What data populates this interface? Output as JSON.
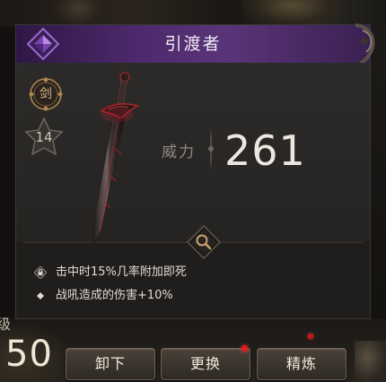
{
  "item": {
    "name": "引渡者",
    "type_badge": "剑",
    "rank": "14",
    "rarity_color": "#6a3a8c",
    "blood_accent": "#b3202a"
  },
  "stat": {
    "label": "威力",
    "value": "261"
  },
  "effects": [
    {
      "icon": "lock-icon",
      "text": "击中时15%几率附加即死"
    },
    {
      "icon": "diamond-bullet-icon",
      "text": "战吼造成的伤害+10%"
    }
  ],
  "background": {
    "level_label": "级",
    "level_value": "50"
  },
  "buttons": {
    "unequip": "卸下",
    "replace": "更换",
    "refine": "精炼"
  }
}
